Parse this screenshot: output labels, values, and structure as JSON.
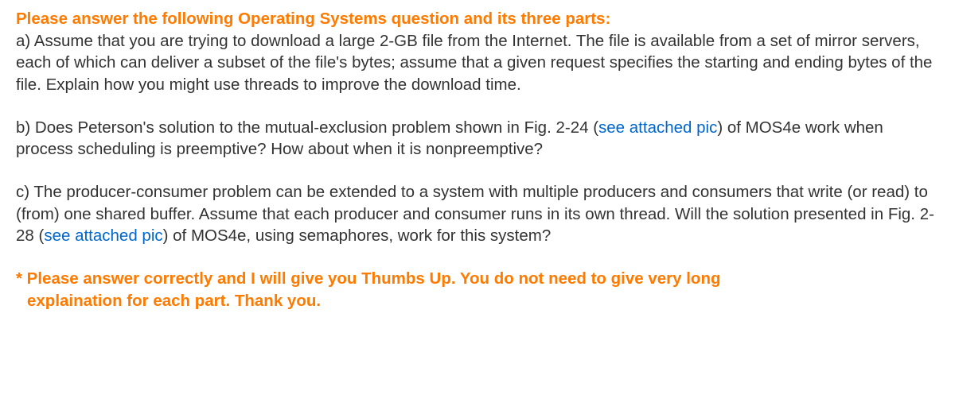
{
  "title": "Please answer the following Operating Systems question and its three parts:",
  "partA": "a) Assume that you are trying to download a large 2-GB file from the Internet. The file is available from a set of mirror servers, each of which can deliver a subset of the file's bytes; assume that a given request specifies the starting and ending bytes of the file. Explain how you might use threads to improve the download time.",
  "partB": {
    "before": "b) Does Peterson's solution to the mutual-exclusion problem shown in Fig. 2-24 (",
    "link": "see attached pic",
    "after": ") of MOS4e work when process scheduling is preemptive? How about when it is nonpreemptive?"
  },
  "partC": {
    "before": "c) The producer-consumer problem can be extended to a system with multiple producers and consumers that write (or read) to (from) one shared buffer. Assume that each producer and consumer runs in its own thread. Will the solution presented in Fig. 2-28 (",
    "link": "see attached pic",
    "after": ") of MOS4e, using semaphores, work for this system?"
  },
  "footer": {
    "line1": "* Please answer correctly and I will give you Thumbs Up. You do not need to give very long",
    "line2": "explaination for each part. Thank you."
  }
}
